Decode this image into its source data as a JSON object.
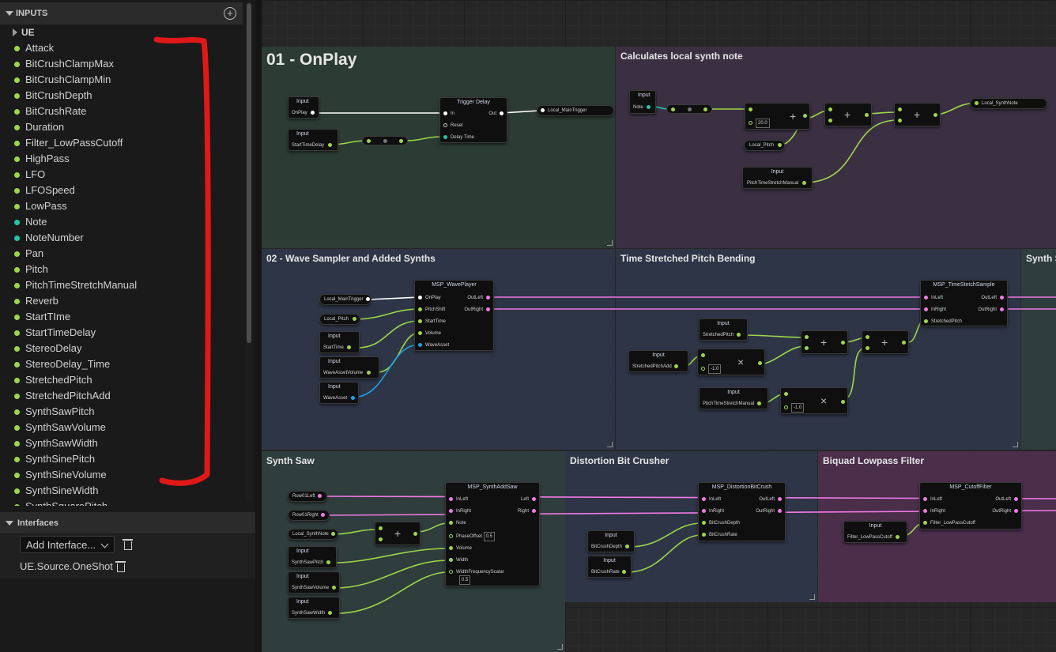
{
  "inputs_panel": {
    "title": "INPUTS",
    "group_label": "UE",
    "items": [
      {
        "label": "Attack",
        "color": "#9dd64a"
      },
      {
        "label": "BitCrushClampMax",
        "color": "#9dd64a"
      },
      {
        "label": "BitCrushClampMin",
        "color": "#9dd64a"
      },
      {
        "label": "BitCrushDepth",
        "color": "#9dd64a"
      },
      {
        "label": "BitCrushRate",
        "color": "#9dd64a"
      },
      {
        "label": "Duration",
        "color": "#9dd64a"
      },
      {
        "label": "Filter_LowPassCutoff",
        "color": "#9dd64a"
      },
      {
        "label": "HighPass",
        "color": "#9dd64a"
      },
      {
        "label": "LFO",
        "color": "#9dd64a"
      },
      {
        "label": "LFOSpeed",
        "color": "#9dd64a"
      },
      {
        "label": "LowPass",
        "color": "#9dd64a"
      },
      {
        "label": "Note",
        "color": "#22c7a8"
      },
      {
        "label": "NoteNumber",
        "color": "#22c7a8"
      },
      {
        "label": "Pan",
        "color": "#9dd64a"
      },
      {
        "label": "Pitch",
        "color": "#9dd64a"
      },
      {
        "label": "PitchTimeStretchManual",
        "color": "#9dd64a"
      },
      {
        "label": "Reverb",
        "color": "#9dd64a"
      },
      {
        "label": "StartTIme",
        "color": "#9dd64a"
      },
      {
        "label": "StartTimeDelay",
        "color": "#9dd64a"
      },
      {
        "label": "StereoDelay",
        "color": "#9dd64a"
      },
      {
        "label": "StereoDelay_Time",
        "color": "#9dd64a"
      },
      {
        "label": "StretchedPitch",
        "color": "#9dd64a"
      },
      {
        "label": "StretchedPitchAdd",
        "color": "#9dd64a"
      },
      {
        "label": "SynthSawPitch",
        "color": "#9dd64a"
      },
      {
        "label": "SynthSawVolume",
        "color": "#9dd64a"
      },
      {
        "label": "SynthSawWidth",
        "color": "#9dd64a"
      },
      {
        "label": "SynthSinePitch",
        "color": "#9dd64a"
      },
      {
        "label": "SynthSineVolume",
        "color": "#9dd64a"
      },
      {
        "label": "SynthSineWidth",
        "color": "#9dd64a"
      },
      {
        "label": "SynthSquarePitch",
        "color": "#9dd64a"
      }
    ]
  },
  "interfaces_panel": {
    "title": "Interfaces",
    "add_button": "Add Interface...",
    "entries": [
      "UE.Source.OneShot"
    ]
  },
  "graph": {
    "comments": [
      {
        "title": "01 - OnPlay",
        "color": "#2c3b33"
      },
      {
        "title": "Calculates local synth note",
        "color": "#3a3042"
      },
      {
        "title": "02 - Wave Sampler and Added Synths",
        "color": "#2e3546"
      },
      {
        "title": "Time Stretched Pitch Bending",
        "color": "#2e3546"
      },
      {
        "title": "Synth S",
        "color": "#2f3d3c"
      },
      {
        "title": "Synth Saw",
        "color": "#2f3d3c"
      },
      {
        "title": "Distortion Bit Crusher",
        "color": "#2e3546"
      },
      {
        "title": "Biquad Lowpass Filter",
        "color": "#4a2e4a"
      }
    ],
    "labels": {
      "input": "Input",
      "trigger_delay": "Trigger Delay",
      "in": "In",
      "out": "Out",
      "reset": "Reset",
      "delay_time": "Delay Time",
      "on_play": "OnPlay",
      "start_time_delay": "StartTimeDelay",
      "local_main_trigger": "Local_MainTrigger",
      "note": "Note",
      "const_20": "20.0",
      "local_pitch": "Local_Pitch",
      "pitch_time_stretch_manual": "PitchTimeStretchManual",
      "local_synth_note": "Local_SynthNote",
      "wave_player": "MSP_WavePlayer",
      "pitch_shift": "PitchShift",
      "start_time": "StartTime",
      "volume": "Volume",
      "wave_asset": "WaveAsset",
      "wave_asset_volume": "WaveAssetVolume",
      "out_left": "OutLeft",
      "out_right": "OutRight",
      "time_stretch": "MSP_TimeStetchSample",
      "in_left": "InLeft",
      "in_right": "InRight",
      "stretched_pitch": "StretchedPitch",
      "stretched_pitch_add": "StretchedPitchAdd",
      "neg_one": "-1.0",
      "synth_add_saw": "MSP_SynthAddSaw",
      "left": "Left",
      "right": "Right",
      "phase_offset": "PhaseOffset",
      "phase_val": "0.5",
      "width": "Width",
      "width_freq": "WidthFrequencyScalar",
      "width_val": "0.5",
      "row01_left": "Row01Left",
      "row01_right": "Row01Right",
      "synth_saw_pitch": "SynthSawPitch",
      "synth_saw_volume": "SynthSawVolume",
      "synth_saw_width": "SynthSawWidth",
      "bitcrush_node": "MSP_DistortionBitCrush",
      "bitcrush_depth": "BitCrushDepth",
      "bitcrush_rate": "BitCrushRate",
      "cutoff_node": "MSP_CutoffFilter",
      "filter_lowpass_cutoff": "Filter_LowPassCutoff"
    }
  }
}
